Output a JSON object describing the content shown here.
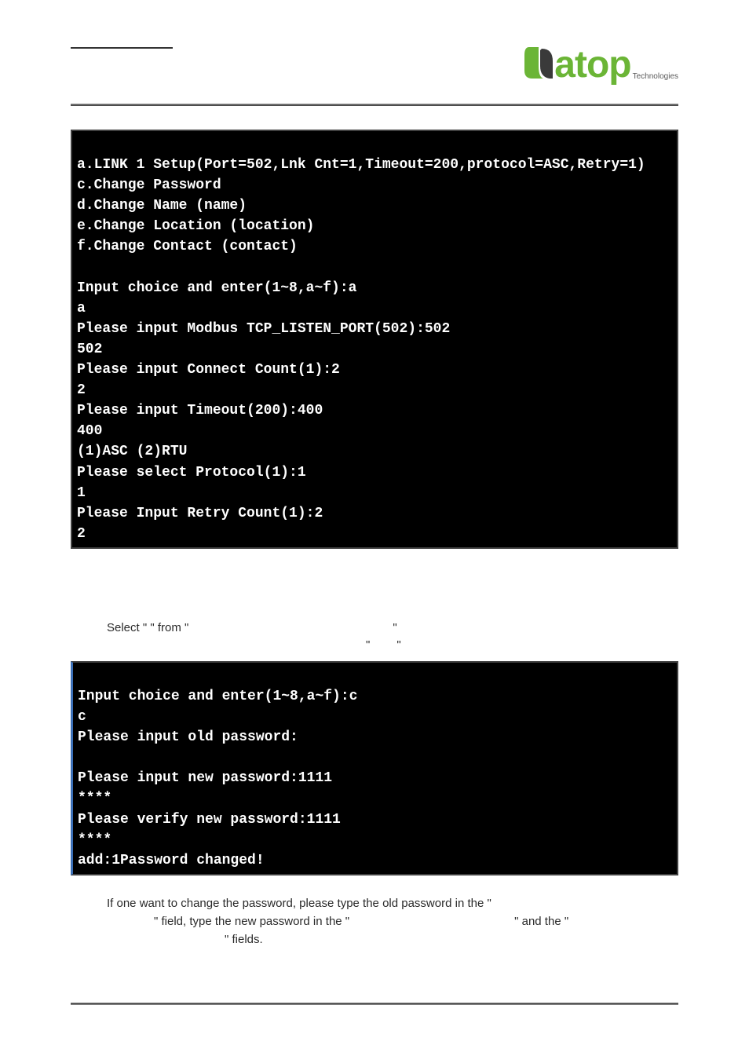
{
  "logo": {
    "brand": "atop",
    "sub": "Technologies"
  },
  "terminal1": {
    "lines": [
      "a.LINK 1 Setup(Port=502,Lnk Cnt=1,Timeout=200,protocol=ASC,Retry=1)",
      "c.Change Password",
      "d.Change Name (name)",
      "e.Change Location (location)",
      "f.Change Contact (contact)",
      "",
      "Input choice and enter(1~8,a~f):a",
      "a",
      "Please input Modbus TCP_LISTEN_PORT(502):502",
      "502",
      "Please input Connect Count(1):2",
      "2",
      "Please input Timeout(200):400",
      "400",
      "(1)ASC (2)RTU",
      "Please select Protocol(1):1",
      "1",
      "Please Input Retry Count(1):2",
      "2"
    ]
  },
  "para1": {
    "line1_a": "Select \"",
    "line1_b": "\" from \"",
    "line1_c": "\"",
    "line2_a": "\"",
    "line2_b": "\""
  },
  "terminal2": {
    "lines": [
      "Input choice and enter(1~8,a~f):c",
      "c",
      "Please input old password:",
      "",
      "Please input new password:1111",
      "****",
      "Please verify new password:1111",
      "****",
      "add:1Password changed!"
    ]
  },
  "para2": {
    "t1": "If one want to change the password, please type the old password in the \"",
    "t2": "\" field, type the new password in the \"",
    "t3": "\" and the \"",
    "t4": "\" fields."
  }
}
